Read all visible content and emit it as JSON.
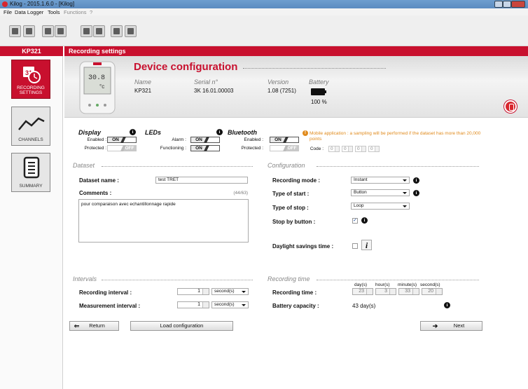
{
  "window": {
    "title": "Kilog - 2015.1.6.0 - [Kilog]"
  },
  "menu": [
    "File",
    "Data Logger",
    "Tools",
    "Functions",
    "?"
  ],
  "toolbar": {
    "buttons": [
      "open-icon",
      "save-icon",
      "zoom-icon",
      "print-icon",
      "download-icon",
      "export-icon",
      "settings-icon",
      "connect-icon"
    ]
  },
  "sidebar": {
    "device": "KP321",
    "items": [
      {
        "label": "RECORDING SETTINGS",
        "icon": "calendar-clock-icon",
        "active": true
      },
      {
        "label": "CHANNELS",
        "icon": "chart-line-icon",
        "active": false
      },
      {
        "label": "SUMMARY",
        "icon": "document-icon",
        "active": false
      }
    ]
  },
  "header": {
    "title": "Recording settings"
  },
  "device": {
    "title": "Device configuration",
    "name_label": "Name",
    "name_value": "KP321",
    "serial_label": "Serial n°",
    "serial_value": "3K 16.01.00003",
    "version_label": "Version",
    "version_value": "1.08 (7251)",
    "battery_label": "Battery",
    "battery_value": "100 %",
    "battery_level": 1.0,
    "screen_reading": "30.8"
  },
  "display": {
    "title": "Display",
    "enabled_label": "Enabled :",
    "enabled_state": "ON",
    "protected_label": "Protected :",
    "protected_state": "OFF"
  },
  "leds": {
    "title": "LEDs",
    "alarm_label": "Alarm :",
    "alarm_state": "ON",
    "functioning_label": "Functioning :",
    "functioning_state": "ON"
  },
  "bluetooth": {
    "title": "Bluetooth",
    "enabled_label": "Enabled :",
    "enabled_state": "ON",
    "protected_label": "Protected :",
    "protected_state": "OFF",
    "warning": "Mobile application : a sampling will be performed if the dataset has more than 20,000 points",
    "code_label": "Code :",
    "code": [
      "0",
      "0",
      "0",
      "0"
    ]
  },
  "dataset": {
    "title": "Dataset",
    "name_label": "Dataset name :",
    "name_value": "test TRET",
    "comments_label": "Comments :",
    "comments_count": "(44/63)",
    "comments_value": "pour comparaison avec echantillonnage rapide"
  },
  "configuration": {
    "title": "Configuration",
    "recording_mode_label": "Recording mode :",
    "recording_mode_value": "Instant",
    "type_of_start_label": "Type of start :",
    "type_of_start_value": "Button",
    "type_of_stop_label": "Type of stop :",
    "type_of_stop_value": "Loop",
    "stop_by_button_label": "Stop by button :",
    "stop_by_button_checked": true,
    "daylight_label": "Daylight savings time :",
    "daylight_checked": false
  },
  "intervals": {
    "title": "Intervals",
    "recording_label": "Recording interval :",
    "recording_value": "1",
    "recording_unit": "second(s)",
    "measurement_label": "Measurement interval :",
    "measurement_value": "1",
    "measurement_unit": "second(s)"
  },
  "recording_time": {
    "title": "Recording time",
    "units": [
      "day(s)",
      "hour(s)",
      "minute(s)",
      "second(s)"
    ],
    "label": "Recording time :",
    "values": [
      "23",
      "3",
      "33",
      "20"
    ],
    "battery_capacity_label": "Battery capacity :",
    "battery_capacity_value": "43 day(s)"
  },
  "buttons": {
    "return": "Return",
    "load": "Load configuration",
    "next": "Next"
  }
}
